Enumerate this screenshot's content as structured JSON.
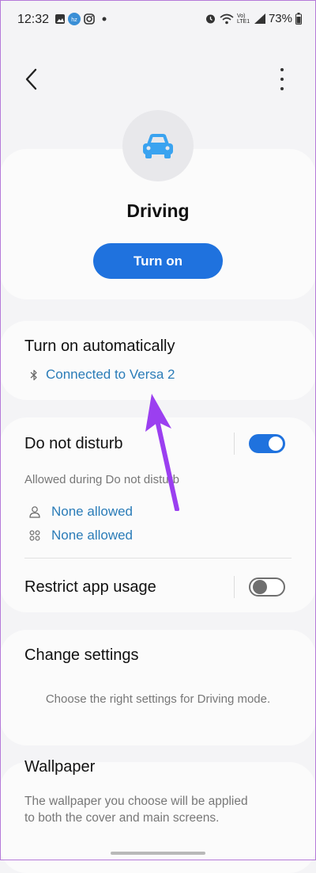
{
  "status_bar": {
    "time": "12:32",
    "battery": "73%",
    "network_label": "Vo) LTE1"
  },
  "toolbar": {
    "back_icon": "chevron-left-icon",
    "more_icon": "more-vertical-icon"
  },
  "mode": {
    "icon": "car-icon",
    "title": "Driving",
    "turn_on_label": "Turn on"
  },
  "auto": {
    "title": "Turn on automatically",
    "connected_label": "Connected to Versa 2"
  },
  "dnd": {
    "title": "Do not disturb",
    "enabled": true,
    "allowed_caption": "Allowed during Do not disturb",
    "people_allowed": "None allowed",
    "apps_allowed": "None allowed"
  },
  "restrict": {
    "title": "Restrict app usage",
    "enabled": false
  },
  "change_settings": {
    "title": "Change settings",
    "description": "Choose the right settings for Driving mode."
  },
  "wallpaper": {
    "title": "Wallpaper",
    "description_line1": "The wallpaper you choose will be applied",
    "description_line2": "to both the cover and main screens."
  },
  "colors": {
    "accent": "#1f72de",
    "link": "#2a7cb8",
    "annotation_arrow": "#9b3ff0"
  }
}
